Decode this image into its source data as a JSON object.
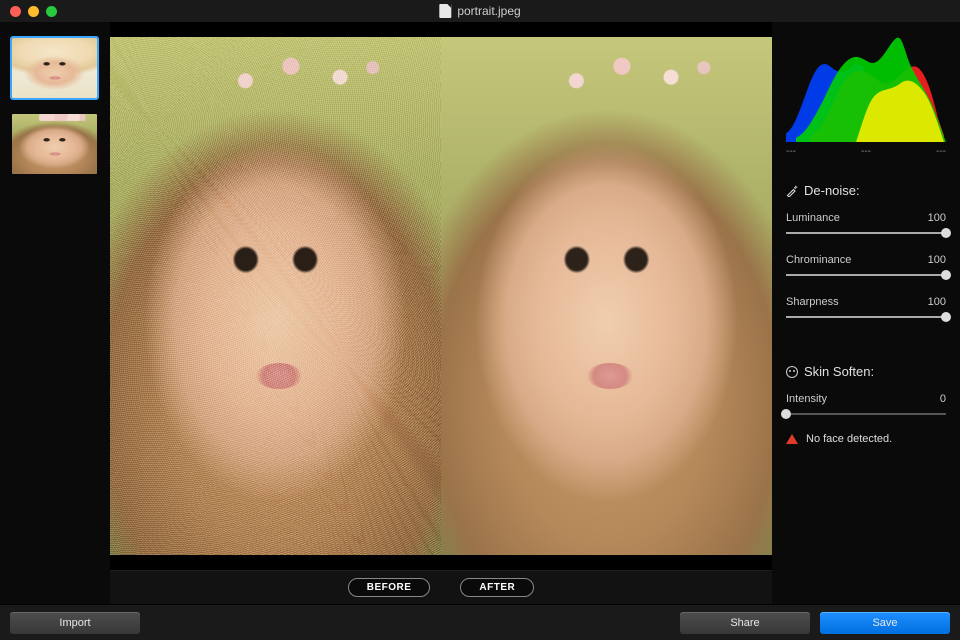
{
  "window": {
    "title": "portrait.jpeg"
  },
  "thumbs": [
    {
      "name": "thumb-hat",
      "selected": true
    },
    {
      "name": "thumb-blossom",
      "selected": false
    }
  ],
  "compare": {
    "before_label": "BEFORE",
    "after_label": "AFTER"
  },
  "sections": {
    "denoise": {
      "title": "De-noise:",
      "sliders": [
        {
          "key": "luminance",
          "label": "Luminance",
          "value": 100,
          "max": 100
        },
        {
          "key": "chrominance",
          "label": "Chrominance",
          "value": 100,
          "max": 100
        },
        {
          "key": "sharpness",
          "label": "Sharpness",
          "value": 100,
          "max": 100
        }
      ]
    },
    "skin": {
      "title": "Skin Soften:",
      "slider": {
        "key": "intensity",
        "label": "Intensity",
        "value": 0,
        "max": 100
      },
      "warning": "No face detected."
    }
  },
  "histogram": {
    "ticks": [
      "---",
      "---",
      "---"
    ]
  },
  "footer": {
    "import": "Import",
    "share": "Share",
    "save": "Save"
  }
}
